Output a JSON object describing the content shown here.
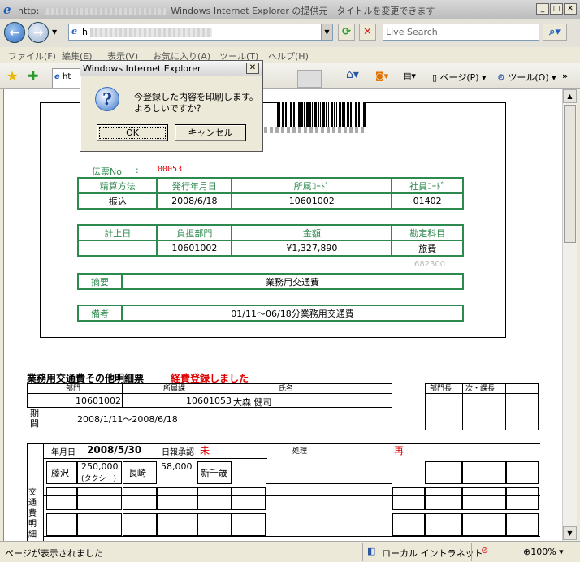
{
  "window": {
    "title": "Windows Internet Explorer の提供元　タイトルを変更できます",
    "url_prefix": "http",
    "title_prefix": "http"
  },
  "toolbar": {
    "search_placeholder": "Live Search",
    "page_label": "ページ(P)",
    "tools_label": "ツール(O)",
    "address_prefix": "h"
  },
  "menu": [
    "ファイル(F)",
    "編集(E)",
    "表示(V)",
    "お気に入り(A)",
    "ツール(T)",
    "ヘルプ(H)"
  ],
  "tab": {
    "label": "ht"
  },
  "dialog": {
    "title": "Windows Internet Explorer",
    "message1": "今登録した内容を印刷します。",
    "message2": "よろしいですか？",
    "ok": "OK",
    "cancel": "キャンセル"
  },
  "voucher": {
    "no_label": "伝票No",
    "colon": ":",
    "no_value": "00053",
    "h1": [
      "精算方法",
      "発行年月日",
      "所属ｺｰﾄﾞ",
      "社員ｺｰﾄﾞ"
    ],
    "r1": [
      "振込",
      "2008/6/18",
      "10601002",
      "01402"
    ],
    "h2": [
      "計上日",
      "負担部門",
      "金額",
      "勘定科目"
    ],
    "r2": [
      "",
      "10601002",
      "¥1,327,890",
      "旅費"
    ],
    "code": "682300",
    "summary_label": "摘要",
    "summary": "業務用交通費",
    "remarks_label": "備考",
    "remarks": "01/11～06/18分業務用交通費"
  },
  "detail": {
    "title": "業務用交通費その他明細票",
    "status": "経費登録しました",
    "h": [
      "部門",
      "所属課",
      "氏名"
    ],
    "r": [
      "10601002",
      "10601053",
      "大森 健司"
    ],
    "approvers": [
      "部門長",
      "次・課長"
    ],
    "period_label": "期間",
    "period": "2008/1/11～2008/6/18",
    "date_label": "年月日",
    "date": "2008/5/30",
    "approval_label": "日報承認",
    "approval_value": "未",
    "process_label": "処理",
    "process_value": "再",
    "side_label": "交通費明細",
    "cells": [
      "藤沢",
      "250,000",
      "(タクシー)",
      "長崎",
      "58,000",
      "新千歳"
    ]
  },
  "status": {
    "text": "ページが表示されました",
    "zone": "ローカル イントラネット",
    "zoom": "100%"
  }
}
